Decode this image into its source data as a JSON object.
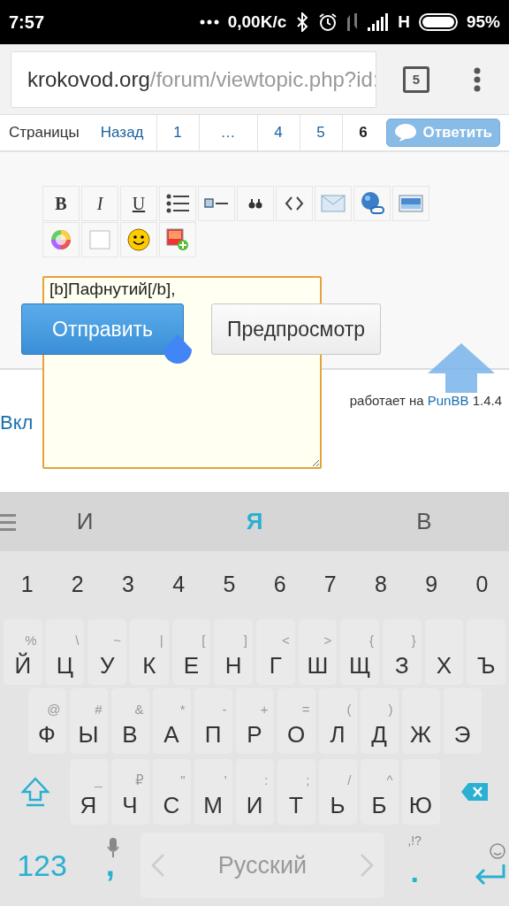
{
  "status_bar": {
    "time": "7:57",
    "speed": "0,00K/с",
    "network": "H",
    "battery": "95%"
  },
  "browser": {
    "url_domain": "krokovod.org",
    "url_path": "/forum/viewtopic.php?id:",
    "tab_count": "5"
  },
  "pagination": {
    "label": "Страницы",
    "items": [
      {
        "text": "Назад",
        "kind": "link",
        "selected": false
      },
      {
        "text": "1",
        "kind": "link",
        "selected": false
      },
      {
        "text": "…",
        "kind": "gap",
        "selected": false
      },
      {
        "text": "4",
        "kind": "link",
        "selected": false
      },
      {
        "text": "5",
        "kind": "link",
        "selected": false
      },
      {
        "text": "6",
        "kind": "link",
        "selected": true
      }
    ],
    "reply_button": "Ответить"
  },
  "editor": {
    "toolbar": [
      {
        "kind": "bold",
        "label": "B"
      },
      {
        "kind": "italic",
        "label": "I"
      },
      {
        "kind": "underline",
        "label": "U"
      },
      {
        "kind": "list"
      },
      {
        "kind": "rule"
      },
      {
        "kind": "quote"
      },
      {
        "kind": "code"
      },
      {
        "kind": "mail"
      },
      {
        "kind": "link"
      },
      {
        "kind": "image"
      },
      {
        "kind": "color"
      },
      {
        "kind": "blank"
      },
      {
        "kind": "smiley"
      },
      {
        "kind": "upload"
      }
    ],
    "message": "[b]Пафнутий[/b],",
    "buttons": [
      {
        "label": "Отправить",
        "kind": "primary"
      },
      {
        "label": "Предпросмотр",
        "kind": "secondary"
      }
    ]
  },
  "footer": {
    "left_link": "Вкл",
    "powered_by": "работает на",
    "engine_link": "PunBB",
    "version": "1.4.4"
  },
  "keyboard": {
    "suggestions": [
      {
        "text": "И",
        "selected": false
      },
      {
        "text": "Я",
        "selected": true
      },
      {
        "text": "В",
        "selected": false
      }
    ],
    "number_row": [
      "1",
      "2",
      "3",
      "4",
      "5",
      "6",
      "7",
      "8",
      "9",
      "0"
    ],
    "rows": [
      [
        {
          "key": "Й",
          "alt": "%"
        },
        {
          "key": "Ц",
          "alt": "\\"
        },
        {
          "key": "У",
          "alt": "~"
        },
        {
          "key": "К",
          "alt": "|"
        },
        {
          "key": "Е",
          "alt": "["
        },
        {
          "key": "Н",
          "alt": "]"
        },
        {
          "key": "Г",
          "alt": "<"
        },
        {
          "key": "Ш",
          "alt": ">"
        },
        {
          "key": "Щ",
          "alt": "{"
        },
        {
          "key": "З",
          "alt": "}"
        },
        {
          "key": "Х"
        },
        {
          "key": "Ъ"
        }
      ],
      [
        {
          "key": "Ф",
          "alt": "@"
        },
        {
          "key": "Ы",
          "alt": "#"
        },
        {
          "key": "В",
          "alt": "&"
        },
        {
          "key": "А",
          "alt": "*"
        },
        {
          "key": "П",
          "alt": "-"
        },
        {
          "key": "Р",
          "alt": "+"
        },
        {
          "key": "О",
          "alt": "="
        },
        {
          "key": "Л",
          "alt": "("
        },
        {
          "key": "Д",
          "alt": ")"
        },
        {
          "key": "Ж"
        },
        {
          "key": "Э"
        }
      ],
      [
        {
          "key": "Я",
          "alt": "_"
        },
        {
          "key": "Ч",
          "alt": "₽"
        },
        {
          "key": "С",
          "alt": "\""
        },
        {
          "key": "М",
          "alt": "'"
        },
        {
          "key": "И",
          "alt": ":"
        },
        {
          "key": "Т",
          "alt": ";"
        },
        {
          "key": "Ь",
          "alt": "/"
        },
        {
          "key": "Б",
          "alt": "^"
        },
        {
          "key": "Ю"
        }
      ]
    ],
    "mode_key": "123",
    "comma_key": ",",
    "space_key": "Русский",
    "period_key": ".",
    "period_hint": ",!?"
  }
}
